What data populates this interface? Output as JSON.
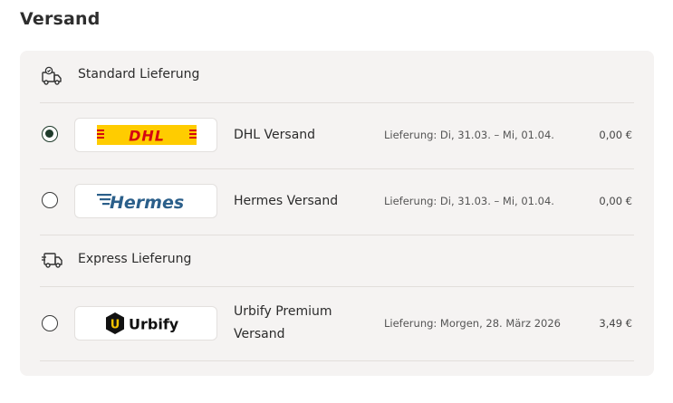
{
  "section": {
    "title": "Versand"
  },
  "groups": {
    "standard": {
      "label": "Standard Lieferung",
      "icon": "delivery-truck-icon"
    },
    "express": {
      "label": "Express Lieferung",
      "icon": "express-truck-icon"
    }
  },
  "options": [
    {
      "carrier": "DHL Versand",
      "logo_text": "DHL",
      "delivery": "Lieferung: Di, 31.03. – Mi, 01.04.",
      "price": "0,00 €",
      "selected": true
    },
    {
      "carrier": "Hermes Versand",
      "logo_text": "Hermes",
      "delivery": "Lieferung: Di, 31.03. – Mi, 01.04.",
      "price": "0,00 €",
      "selected": false
    },
    {
      "carrier_line1": "Urbify Premium",
      "carrier_line2": "Versand",
      "logo_text": "Urbify",
      "logo_mark": "U",
      "delivery": "Lieferung: Morgen, 28. März 2026",
      "price": "3,49 €",
      "selected": false
    }
  ],
  "colors": {
    "dhl_yellow": "#ffcc00",
    "dhl_red": "#d40511",
    "hermes_blue": "#2b5f8a",
    "radio_selected": "#1f3b2b",
    "urbify_yellow": "#f5c400",
    "panel_bg": "#f5f3f2"
  }
}
